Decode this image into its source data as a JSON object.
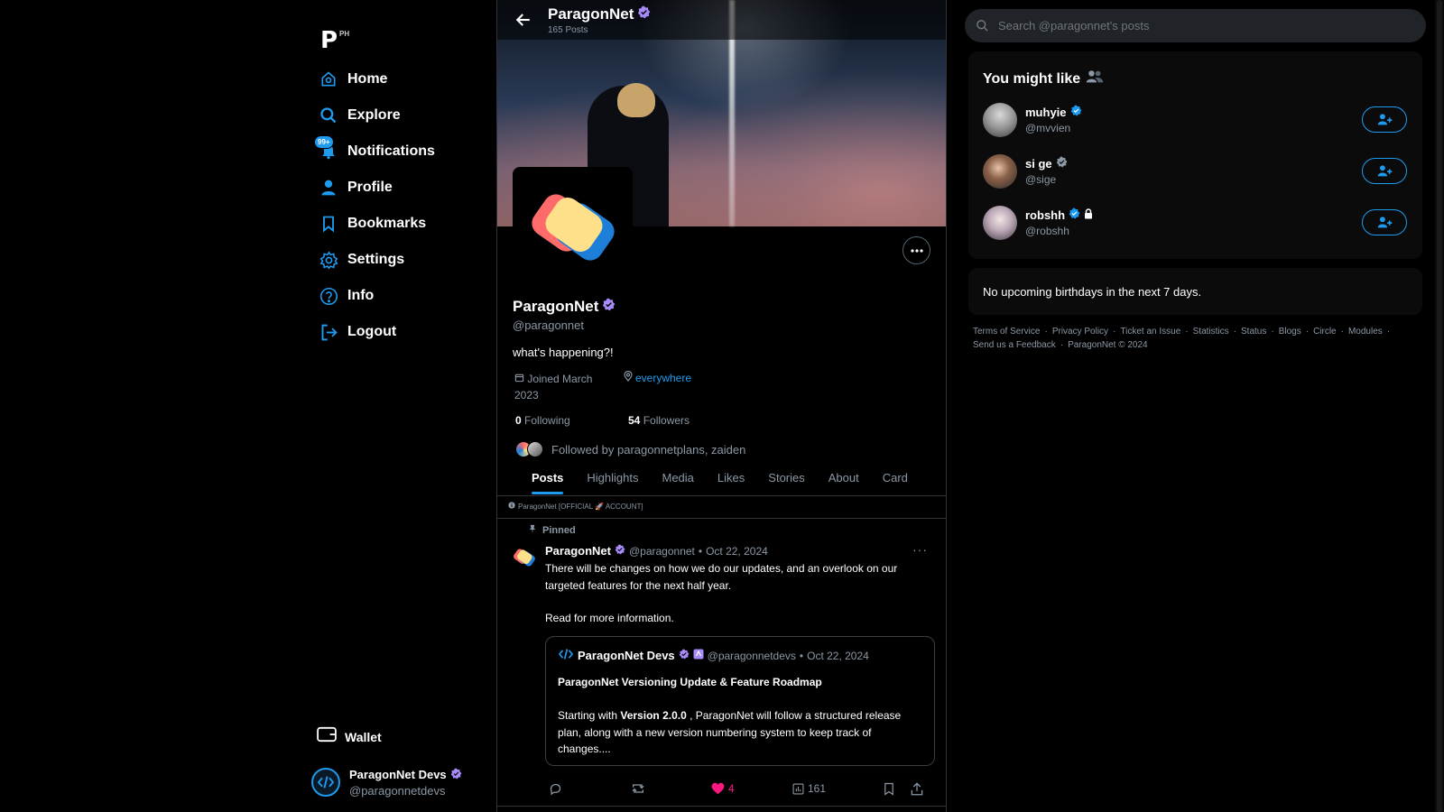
{
  "logo": {
    "letter": "P",
    "superscript": "PH"
  },
  "nav": {
    "items": [
      {
        "label": "Home",
        "icon": "home-icon"
      },
      {
        "label": "Explore",
        "icon": "search-icon"
      },
      {
        "label": "Notifications",
        "icon": "bell-icon",
        "badge": "99+"
      },
      {
        "label": "Profile",
        "icon": "user-icon"
      },
      {
        "label": "Bookmarks",
        "icon": "bookmark-icon"
      },
      {
        "label": "Settings",
        "icon": "gear-icon"
      },
      {
        "label": "Info",
        "icon": "question-icon"
      },
      {
        "label": "Logout",
        "icon": "logout-icon"
      }
    ],
    "wallet_label": "Wallet"
  },
  "account": {
    "name": "ParagonNet Devs",
    "handle": "@paragonnetdevs"
  },
  "header": {
    "title": "ParagonNet",
    "posts_count": "165 Posts"
  },
  "profile": {
    "name": "ParagonNet",
    "handle": "@paragonnet",
    "bio": "what's happening?!",
    "joined": "Joined March 2023",
    "location": "everywhere",
    "following_count": "0",
    "following_label": "Following",
    "followers_count": "54",
    "followers_label": "Followers",
    "followed_by": "Followed by paragonnetplans, zaiden"
  },
  "tabs": [
    "Posts",
    "Highlights",
    "Media",
    "Likes",
    "Stories",
    "About",
    "Card"
  ],
  "official_note": "ParagonNet [OFFICIAL 🚀 ACCOUNT]",
  "post": {
    "pinned_label": "Pinned",
    "author": "ParagonNet",
    "handle": "@paragonnet",
    "date": "Oct 22, 2024",
    "text_1": "There will be changes on how we do our updates, and an overlook on our targeted features for the next half year.",
    "text_2": "Read for more information.",
    "quote": {
      "author": "ParagonNet Devs",
      "handle": "@paragonnetdevs",
      "date": "Oct 22, 2024",
      "title": "ParagonNet Versioning Update & Feature Roadmap",
      "body_prefix": "Starting with ",
      "body_version": "Version 2.0.0",
      "body_suffix": " , ParagonNet will follow a structured release plan, along with a new version numbering system to keep track of changes...."
    },
    "likes": "4",
    "views": "161"
  },
  "search": {
    "placeholder": "Search @paragonnet's posts"
  },
  "suggestions": {
    "title": "You might like",
    "users": [
      {
        "name": "muhyie",
        "handle": "@mvvien",
        "verified_color": "#1d9bf0"
      },
      {
        "name": "si ge",
        "handle": "@sige",
        "verified_color": "#8b98a5"
      },
      {
        "name": "robshh",
        "handle": "@robshh",
        "verified_color": "#1d9bf0",
        "locked": true
      }
    ]
  },
  "birthdays": {
    "text": "No upcoming birthdays in the next 7 days."
  },
  "footer": {
    "links": [
      "Terms of Service",
      "Privacy Policy",
      "Ticket an Issue",
      "Statistics",
      "Status",
      "Blogs",
      "Circle",
      "Modules",
      "Send us a Feedback",
      "ParagonNet © 2024"
    ]
  },
  "colors": {
    "accent": "#1d9bf0",
    "verified_purple": "#a78bfa",
    "like": "#f91880",
    "background": "#000000"
  }
}
